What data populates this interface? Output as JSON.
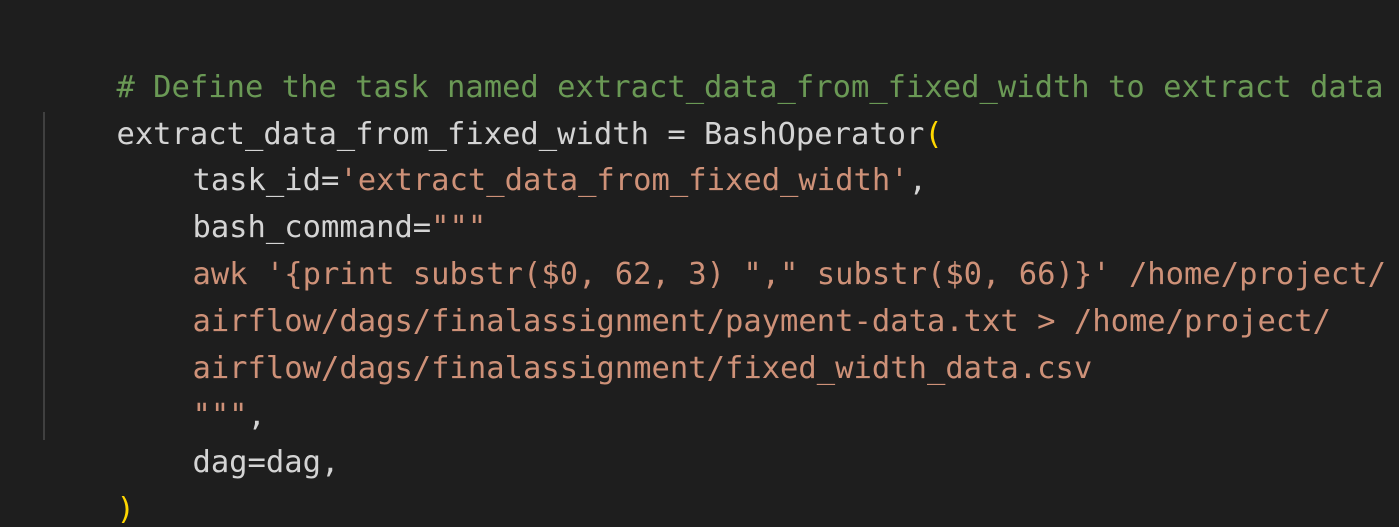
{
  "code": {
    "comment": "# Define the task named extract_data_from_fixed_width to extract data",
    "assign_prefix": "extract_data_from_fixed_width = BashOperator",
    "open_paren": "(",
    "task_id_key": "task_id=",
    "task_id_value": "'extract_data_from_fixed_width'",
    "task_id_comma": ",",
    "bash_command_key": "bash_command=",
    "bash_command_open": "\"\"\"",
    "awk_line_1": "awk '{print substr($0, 62, 3) \",\" substr($0, 66)}' /home/project/",
    "awk_line_2": "airflow/dags/finalassignment/payment-data.txt > /home/project/",
    "awk_line_3": "airflow/dags/finalassignment/fixed_width_data.csv",
    "bash_command_close": "\"\"\"",
    "bash_command_comma": ",",
    "dag_arg": "dag=dag,",
    "close_paren": ")"
  },
  "colors": {
    "background": "#1e1e1e",
    "comment": "#6a9955",
    "text": "#d4d4d4",
    "string": "#ce9178",
    "bracket": "#ffd700",
    "indent_guide": "#404040"
  }
}
